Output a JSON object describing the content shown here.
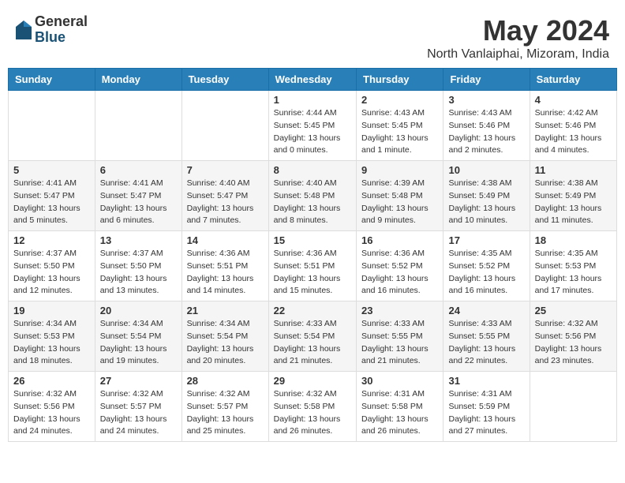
{
  "logo": {
    "general": "General",
    "blue": "Blue"
  },
  "title": {
    "month": "May 2024",
    "location": "North Vanlaiphai, Mizoram, India"
  },
  "headers": [
    "Sunday",
    "Monday",
    "Tuesday",
    "Wednesday",
    "Thursday",
    "Friday",
    "Saturday"
  ],
  "weeks": [
    [
      {
        "day": "",
        "info": ""
      },
      {
        "day": "",
        "info": ""
      },
      {
        "day": "",
        "info": ""
      },
      {
        "day": "1",
        "info": "Sunrise: 4:44 AM\nSunset: 5:45 PM\nDaylight: 13 hours\nand 0 minutes."
      },
      {
        "day": "2",
        "info": "Sunrise: 4:43 AM\nSunset: 5:45 PM\nDaylight: 13 hours\nand 1 minute."
      },
      {
        "day": "3",
        "info": "Sunrise: 4:43 AM\nSunset: 5:46 PM\nDaylight: 13 hours\nand 2 minutes."
      },
      {
        "day": "4",
        "info": "Sunrise: 4:42 AM\nSunset: 5:46 PM\nDaylight: 13 hours\nand 4 minutes."
      }
    ],
    [
      {
        "day": "5",
        "info": "Sunrise: 4:41 AM\nSunset: 5:47 PM\nDaylight: 13 hours\nand 5 minutes."
      },
      {
        "day": "6",
        "info": "Sunrise: 4:41 AM\nSunset: 5:47 PM\nDaylight: 13 hours\nand 6 minutes."
      },
      {
        "day": "7",
        "info": "Sunrise: 4:40 AM\nSunset: 5:47 PM\nDaylight: 13 hours\nand 7 minutes."
      },
      {
        "day": "8",
        "info": "Sunrise: 4:40 AM\nSunset: 5:48 PM\nDaylight: 13 hours\nand 8 minutes."
      },
      {
        "day": "9",
        "info": "Sunrise: 4:39 AM\nSunset: 5:48 PM\nDaylight: 13 hours\nand 9 minutes."
      },
      {
        "day": "10",
        "info": "Sunrise: 4:38 AM\nSunset: 5:49 PM\nDaylight: 13 hours\nand 10 minutes."
      },
      {
        "day": "11",
        "info": "Sunrise: 4:38 AM\nSunset: 5:49 PM\nDaylight: 13 hours\nand 11 minutes."
      }
    ],
    [
      {
        "day": "12",
        "info": "Sunrise: 4:37 AM\nSunset: 5:50 PM\nDaylight: 13 hours\nand 12 minutes."
      },
      {
        "day": "13",
        "info": "Sunrise: 4:37 AM\nSunset: 5:50 PM\nDaylight: 13 hours\nand 13 minutes."
      },
      {
        "day": "14",
        "info": "Sunrise: 4:36 AM\nSunset: 5:51 PM\nDaylight: 13 hours\nand 14 minutes."
      },
      {
        "day": "15",
        "info": "Sunrise: 4:36 AM\nSunset: 5:51 PM\nDaylight: 13 hours\nand 15 minutes."
      },
      {
        "day": "16",
        "info": "Sunrise: 4:36 AM\nSunset: 5:52 PM\nDaylight: 13 hours\nand 16 minutes."
      },
      {
        "day": "17",
        "info": "Sunrise: 4:35 AM\nSunset: 5:52 PM\nDaylight: 13 hours\nand 16 minutes."
      },
      {
        "day": "18",
        "info": "Sunrise: 4:35 AM\nSunset: 5:53 PM\nDaylight: 13 hours\nand 17 minutes."
      }
    ],
    [
      {
        "day": "19",
        "info": "Sunrise: 4:34 AM\nSunset: 5:53 PM\nDaylight: 13 hours\nand 18 minutes."
      },
      {
        "day": "20",
        "info": "Sunrise: 4:34 AM\nSunset: 5:54 PM\nDaylight: 13 hours\nand 19 minutes."
      },
      {
        "day": "21",
        "info": "Sunrise: 4:34 AM\nSunset: 5:54 PM\nDaylight: 13 hours\nand 20 minutes."
      },
      {
        "day": "22",
        "info": "Sunrise: 4:33 AM\nSunset: 5:54 PM\nDaylight: 13 hours\nand 21 minutes."
      },
      {
        "day": "23",
        "info": "Sunrise: 4:33 AM\nSunset: 5:55 PM\nDaylight: 13 hours\nand 21 minutes."
      },
      {
        "day": "24",
        "info": "Sunrise: 4:33 AM\nSunset: 5:55 PM\nDaylight: 13 hours\nand 22 minutes."
      },
      {
        "day": "25",
        "info": "Sunrise: 4:32 AM\nSunset: 5:56 PM\nDaylight: 13 hours\nand 23 minutes."
      }
    ],
    [
      {
        "day": "26",
        "info": "Sunrise: 4:32 AM\nSunset: 5:56 PM\nDaylight: 13 hours\nand 24 minutes."
      },
      {
        "day": "27",
        "info": "Sunrise: 4:32 AM\nSunset: 5:57 PM\nDaylight: 13 hours\nand 24 minutes."
      },
      {
        "day": "28",
        "info": "Sunrise: 4:32 AM\nSunset: 5:57 PM\nDaylight: 13 hours\nand 25 minutes."
      },
      {
        "day": "29",
        "info": "Sunrise: 4:32 AM\nSunset: 5:58 PM\nDaylight: 13 hours\nand 26 minutes."
      },
      {
        "day": "30",
        "info": "Sunrise: 4:31 AM\nSunset: 5:58 PM\nDaylight: 13 hours\nand 26 minutes."
      },
      {
        "day": "31",
        "info": "Sunrise: 4:31 AM\nSunset: 5:59 PM\nDaylight: 13 hours\nand 27 minutes."
      },
      {
        "day": "",
        "info": ""
      }
    ]
  ]
}
